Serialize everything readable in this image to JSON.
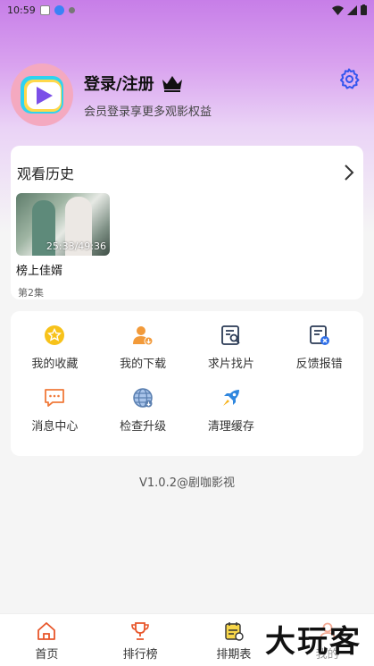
{
  "status_bar": {
    "time": "10:59"
  },
  "profile": {
    "login_label": "登录/注册",
    "subtitle": "会员登录享更多观影权益"
  },
  "history": {
    "title": "观看历史",
    "items": [
      {
        "title": "榜上佳婿",
        "progress": "25:33/49:36",
        "episode": "第2集"
      }
    ]
  },
  "menu": [
    {
      "label": "我的收藏",
      "icon": "star-icon",
      "color": "#f7c21a"
    },
    {
      "label": "我的下载",
      "icon": "user-download-icon",
      "color": "#f29a3a"
    },
    {
      "label": "求片找片",
      "icon": "search-doc-icon",
      "color": "#2a3a55"
    },
    {
      "label": "反馈报错",
      "icon": "feedback-doc-icon",
      "color": "#2a3a55"
    },
    {
      "label": "消息中心",
      "icon": "message-icon",
      "color": "#f07a3a"
    },
    {
      "label": "检查升级",
      "icon": "globe-icon",
      "color": "#5a7fb0"
    },
    {
      "label": "清理缓存",
      "icon": "rocket-icon",
      "color": "#2e86de"
    }
  ],
  "version": "V1.0.2@剧咖影视",
  "tabbar": [
    {
      "label": "首页",
      "icon": "home-icon"
    },
    {
      "label": "排行榜",
      "icon": "trophy-icon"
    },
    {
      "label": "排期表",
      "icon": "schedule-icon"
    },
    {
      "label": "我的",
      "icon": "profile-icon"
    }
  ],
  "watermark": "大玩客",
  "colors": {
    "accent": "#3355ee",
    "tab_icon": "#e8562a",
    "bg_top": "#c77ee8"
  }
}
